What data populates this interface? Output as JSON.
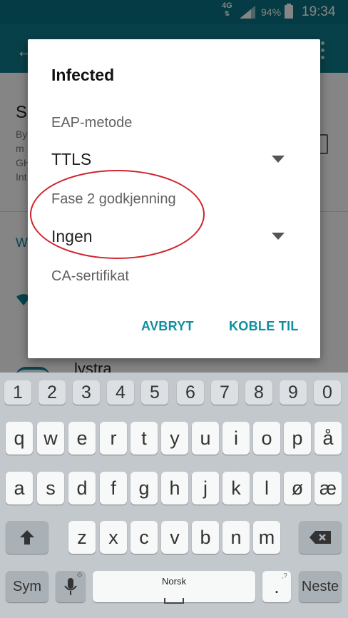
{
  "status_bar": {
    "network": "4G",
    "battery": "94%",
    "time": "19:34"
  },
  "background": {
    "title_fragment": "S",
    "subtitle_lines": [
      "By",
      "m",
      "GH",
      "Int"
    ],
    "section_fragment": "W",
    "network_name": "lystra"
  },
  "dialog": {
    "title": "Infected",
    "eap_label": "EAP-metode",
    "eap_value": "TTLS",
    "phase2_label": "Fase 2 godkjenning",
    "phase2_value": "Ingen",
    "ca_label": "CA-sertifikat",
    "cancel_label": "AVBRYT",
    "connect_label": "KOBLE TIL"
  },
  "keyboard": {
    "number_row": [
      "1",
      "2",
      "3",
      "4",
      "5",
      "6",
      "7",
      "8",
      "9",
      "0"
    ],
    "row1": [
      "q",
      "w",
      "e",
      "r",
      "t",
      "y",
      "u",
      "i",
      "o",
      "p",
      "å"
    ],
    "row2": [
      "a",
      "s",
      "d",
      "f",
      "g",
      "h",
      "j",
      "k",
      "l",
      "ø",
      "æ"
    ],
    "row3": [
      "z",
      "x",
      "c",
      "v",
      "b",
      "n",
      "m"
    ],
    "sym_label": "Sym",
    "space_label": "Norsk",
    "period_label": ".",
    "period_hint": ",?",
    "next_label": "Neste"
  }
}
